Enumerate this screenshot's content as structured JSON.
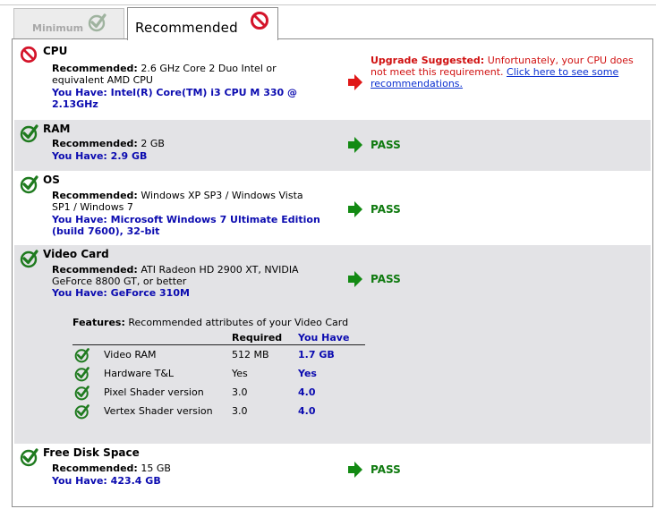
{
  "tabs": {
    "minimum": "Minimum",
    "recommended": "Recommended"
  },
  "colors": {
    "pass": "#0f7a0f",
    "fail": "#d01010",
    "have": "#0b0bb0",
    "link": "#0a2fd0",
    "shade": "#e3e3e6"
  },
  "cpu": {
    "title": "CPU",
    "rec_label": "Recommended:",
    "rec_value_1": "2.6 GHz Core 2 Duo Intel or",
    "rec_value_2": "equivalent AMD CPU",
    "have_1": "You Have: Intel(R) Core(TM) i3 CPU M 330 @",
    "have_2": "2.13GHz",
    "warn_label": "Upgrade Suggested:",
    "warn_text_1": " Unfortunately, your CPU does",
    "warn_text_2": "not meet this requirement. ",
    "warn_link_1": "Click here to see some",
    "warn_link_2": "recommendations."
  },
  "ram": {
    "title": "RAM",
    "rec_label": "Recommended:",
    "rec_value": " 2 GB",
    "have": "You Have: 2.9 GB",
    "status": "PASS"
  },
  "os": {
    "title": "OS",
    "rec_label": "Recommended:",
    "rec_value_1": " Windows XP SP3 / Windows Vista",
    "rec_value_2": "SP1 / Windows 7",
    "have_1": "You Have: Microsoft Windows 7 Ultimate Edition",
    "have_2": "(build 7600), 32-bit",
    "status": "PASS"
  },
  "video": {
    "title": "Video Card",
    "rec_label": "Recommended:",
    "rec_value_1": " ATI Radeon HD 2900 XT, NVIDIA",
    "rec_value_2": "GeForce 8800 GT, or better",
    "have": "You Have: GeForce 310M",
    "status": "PASS",
    "features_label": "Features:",
    "features_text": " Recommended attributes of your Video Card",
    "col_required": "Required",
    "col_have": "You Have",
    "features": [
      {
        "name": "Video RAM",
        "required": "512 MB",
        "have": "1.7 GB"
      },
      {
        "name": "Hardware T&L",
        "required": "Yes",
        "have": "Yes"
      },
      {
        "name": "Pixel Shader version",
        "required": "3.0",
        "have": "4.0"
      },
      {
        "name": "Vertex Shader version",
        "required": "3.0",
        "have": "4.0"
      }
    ]
  },
  "disk": {
    "title": "Free Disk Space",
    "rec_label": "Recommended:",
    "rec_value": " 15 GB",
    "have": "You Have: 423.4 GB",
    "status": "PASS"
  }
}
